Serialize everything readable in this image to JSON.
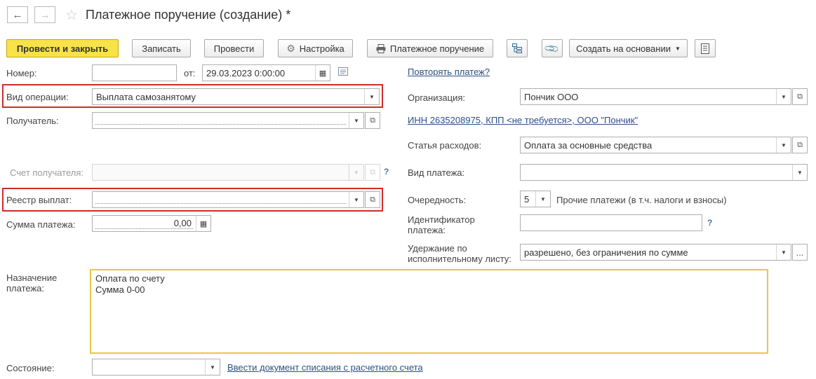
{
  "header": {
    "title": "Платежное поручение (создание) *"
  },
  "toolbar": {
    "post_close": "Провести и закрыть",
    "save": "Записать",
    "post": "Провести",
    "settings": "Настройка",
    "print_order": "Платежное поручение",
    "create_based": "Создать на основании"
  },
  "left": {
    "number_label": "Номер:",
    "number_value": "",
    "date_from_label": "от:",
    "date_value": "29.03.2023  0:00:00",
    "operation_label": "Вид операции:",
    "operation_value": "Выплата самозанятому",
    "recipient_label": "Получатель:",
    "recipient_account_label": "Счет получателя:",
    "payment_registry_label": "Реестр выплат:",
    "amount_label": "Сумма платежа:",
    "amount_value": "0,00",
    "purpose_label": "Назначение платежа:",
    "purpose_line1": "Оплата по счету",
    "purpose_line2": "Сумма 0-00",
    "state_label": "Состояние:",
    "writeoff_link": "Ввести документ списания с расчетного счета"
  },
  "right": {
    "repeat_link": "Повторять платеж?",
    "org_label": "Организация:",
    "org_value": "Пончик ООО",
    "inn_link": "ИНН 2635208975, КПП <не требуется>, ООО \"Пончик\"",
    "expense_label": "Статья расходов:",
    "expense_value": "Оплата за основные средства",
    "payment_kind_label": "Вид платежа:",
    "priority_label": "Очередность:",
    "priority_value": "5",
    "priority_desc": "Прочие платежи (в т.ч. налоги и взносы)",
    "payment_id_label_1": "Идентификатор",
    "payment_id_label_2": "платежа:",
    "withholding_label_1": "Удержание по",
    "withholding_label_2": "исполнительному листу:",
    "withholding_value": "разрешено, без ограничения по сумме"
  },
  "accent": {
    "highlight_border": "#d12a2a",
    "primary_button": "#f8e24a",
    "link": "#2b4f84"
  }
}
